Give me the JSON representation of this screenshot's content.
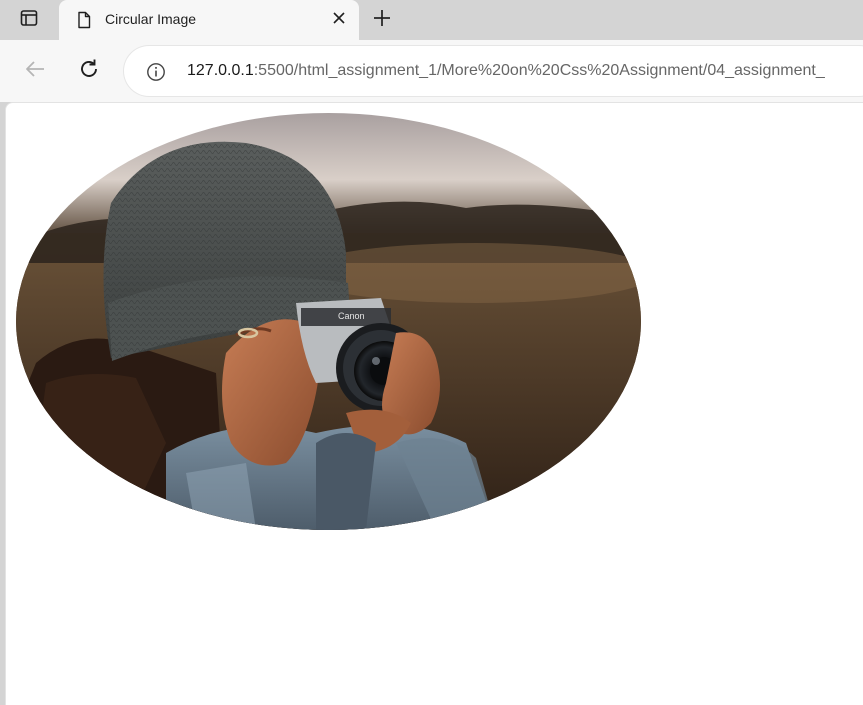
{
  "browser": {
    "tab": {
      "title": "Circular Image",
      "favicon": "document-icon",
      "close_icon": "close-icon"
    },
    "new_tab_icon": "plus-icon",
    "tab_actions_icon": "tab-actions-icon"
  },
  "toolbar": {
    "back_icon": "arrow-left-icon",
    "reload_icon": "reload-icon",
    "site_info_icon": "info-icon",
    "url": {
      "host": "127.0.0.1",
      "rest": ":5500/html_assignment_1/More%20on%20Css%20Assignment/04_assignment_"
    }
  },
  "page": {
    "image": {
      "subject": "person in knit beanie and denim jacket holding a Canon film camera in a field",
      "camera_brand": "Canon",
      "shape": "ellipse"
    }
  },
  "colors": {
    "tabstrip_bg": "#d4d4d4",
    "toolbar_bg": "#f7f7f7",
    "page_bg": "#ffffff",
    "url_host": "#1a1a1a",
    "url_rest": "#666666"
  }
}
